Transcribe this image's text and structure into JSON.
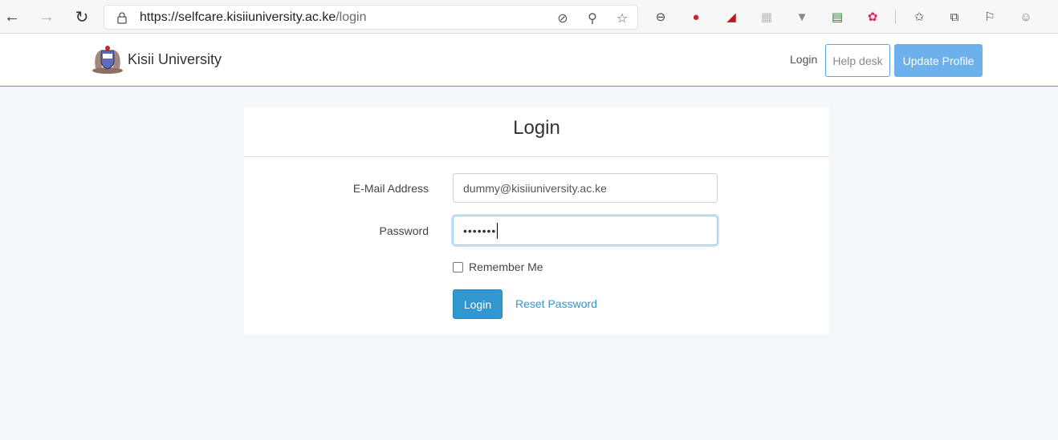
{
  "browser": {
    "url_host": "https://selfcare.kisiiuniversity.ac.ke",
    "url_path": "/login",
    "back_icon": "←",
    "forward_icon": "→",
    "refresh_icon": "↻",
    "lock_icon": "lock-icon",
    "extensions": [
      {
        "name": "tracking-prevention-icon",
        "glyph": "⊘"
      },
      {
        "name": "key-icon",
        "glyph": "⚲"
      },
      {
        "name": "favorite-star-icon",
        "glyph": "☆"
      },
      {
        "name": "reader-icon",
        "glyph": "⊖"
      },
      {
        "name": "extension-red-icon",
        "glyph": "●"
      },
      {
        "name": "extension-acrobat-icon",
        "glyph": "◢"
      },
      {
        "name": "extension-grey-icon",
        "glyph": "▦"
      },
      {
        "name": "extension-v-icon",
        "glyph": "▼"
      },
      {
        "name": "extension-sheet-icon",
        "glyph": "▤"
      },
      {
        "name": "extension-color-icon",
        "glyph": "✿"
      },
      {
        "name": "favorites-list-icon",
        "glyph": "✩"
      },
      {
        "name": "collections-icon",
        "glyph": "⧉"
      },
      {
        "name": "feedback-icon",
        "glyph": "⚐"
      },
      {
        "name": "profile-avatar-icon",
        "glyph": "☺"
      }
    ]
  },
  "navbar": {
    "brand_name": "Kisii University",
    "login_link": "Login",
    "help_desk": "Help desk",
    "update_profile": "Update Profile"
  },
  "login": {
    "title": "Login",
    "email_label": "E-Mail Address",
    "email_value": "dummy@kisiiuniversity.ac.ke",
    "password_label": "Password",
    "password_value": "•••••••",
    "remember_me": "Remember Me",
    "submit": "Login",
    "reset_password": "Reset Password"
  },
  "colors": {
    "accent": "#3097d1",
    "navbar_border": "#4caf50",
    "update_profile_bg": "#6cb1ec"
  }
}
